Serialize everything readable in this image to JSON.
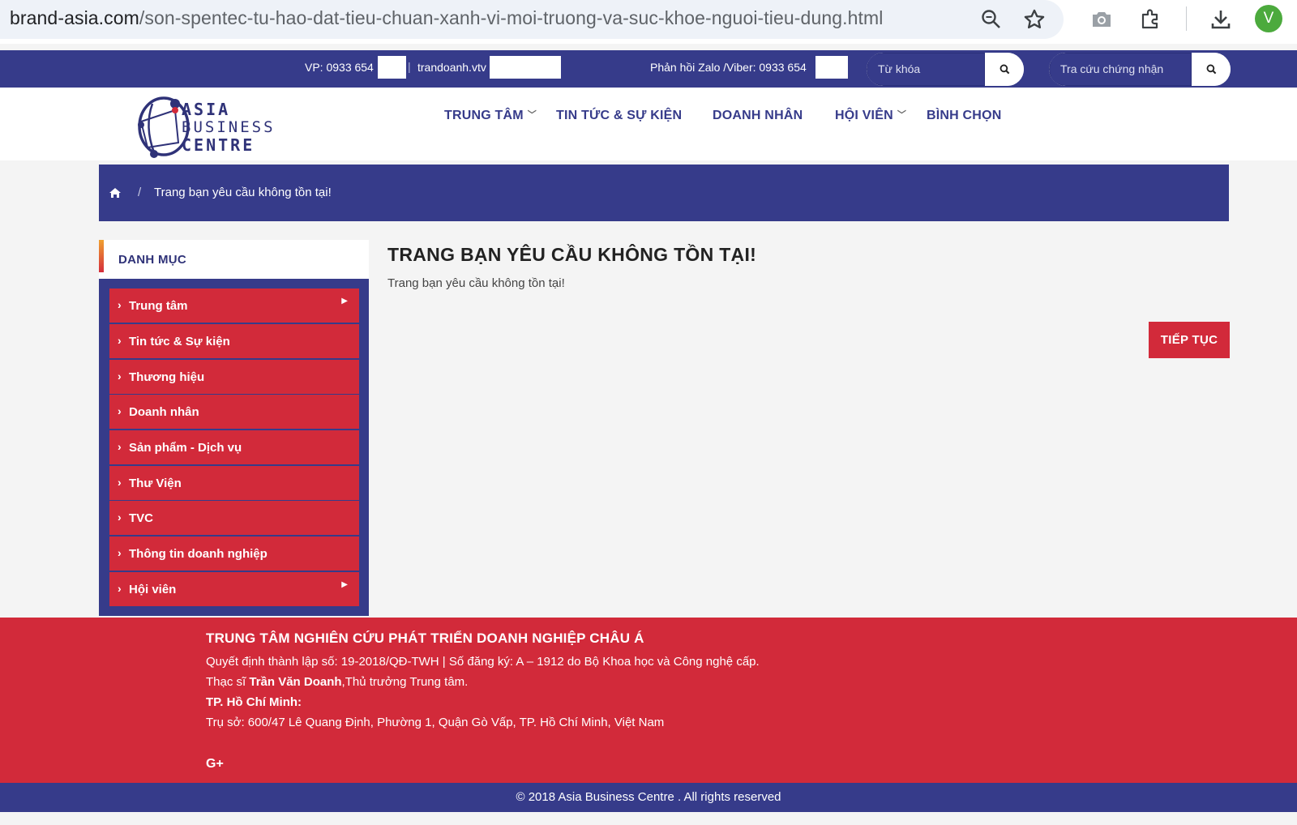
{
  "browser": {
    "url_host": "brand-asia.com",
    "url_path": "/son-spentec-tu-hao-dat-tieu-chuan-xanh-vi-moi-truong-va-suc-khoe-nguoi-tieu-dung.html",
    "avatar_letter": "V",
    "icons": [
      "zoom-icon",
      "star-icon",
      "camera-icon",
      "extensions-icon",
      "download-icon"
    ]
  },
  "topbar": {
    "phone_label": "VP: 0933 654",
    "email_label": "trandoanh.vtv",
    "zalo_label": "Phản hồi Zalo /Viber: 0933 654",
    "search_placeholder": "Từ khóa",
    "lookup_placeholder": "Tra cứu chứng nhận"
  },
  "logo": {
    "line1": "ASIA",
    "line2": "BUSINESS",
    "line3": "CENTRE"
  },
  "nav": {
    "items": [
      {
        "label": "TRUNG TÂM",
        "has_dropdown": true
      },
      {
        "label": "TIN TỨC & SỰ KIỆN",
        "has_dropdown": false
      },
      {
        "label": "DOANH NHÂN",
        "has_dropdown": false
      },
      {
        "label": "HỘI VIÊN",
        "has_dropdown": true
      },
      {
        "label": "BÌNH CHỌN",
        "has_dropdown": false
      }
    ]
  },
  "breadcrumb": {
    "separator": "/",
    "current": "Trang bạn yêu cầu không tồn tại!"
  },
  "sidebar": {
    "title": "DANH MỤC",
    "items": [
      {
        "label": "Trung tâm",
        "has_submenu": true
      },
      {
        "label": "Tin tức & Sự kiện",
        "has_submenu": false
      },
      {
        "label": "Thương hiệu",
        "has_submenu": false
      },
      {
        "label": "Doanh nhân",
        "has_submenu": false
      },
      {
        "label": "Sản phẩm - Dịch vụ",
        "has_submenu": false
      },
      {
        "label": "Thư Viện",
        "has_submenu": false
      },
      {
        "label": "TVC",
        "has_submenu": false
      },
      {
        "label": "Thông tin doanh nghiệp",
        "has_submenu": false
      },
      {
        "label": "Hội viên",
        "has_submenu": true
      }
    ]
  },
  "main": {
    "title": "TRANG BẠN YÊU CẦU KHÔNG TỒN TẠI!",
    "message": "Trang bạn yêu cầu không tồn tại!",
    "continue_label": "TIẾP TỤC"
  },
  "footer": {
    "org_name": "TRUNG TÂM NGHIÊN CỨU PHÁT TRIỂN DOANH NGHIỆP CHÂU Á",
    "decision": "Quyết định thành lập số: 19-2018/QĐ-TWH | Số đăng ký: A – 1912 do Bộ Khoa học và Công nghệ cấp.",
    "director_prefix": "Thạc sĩ ",
    "director_name": "Trần Văn Doanh",
    "director_suffix": ",Thủ trưởng Trung tâm.",
    "city": "TP. Hồ Chí Minh:",
    "address": "Trụ sở: 600/47 Lê Quang Định, Phường 1, Quận Gò Vấp, TP. Hồ Chí Minh, Việt Nam",
    "social": "G+",
    "copyright": "© 2018 Asia Business Centre . All rights reserved"
  },
  "colors": {
    "primary_blue": "#363b8a",
    "primary_red": "#d22a3a"
  }
}
